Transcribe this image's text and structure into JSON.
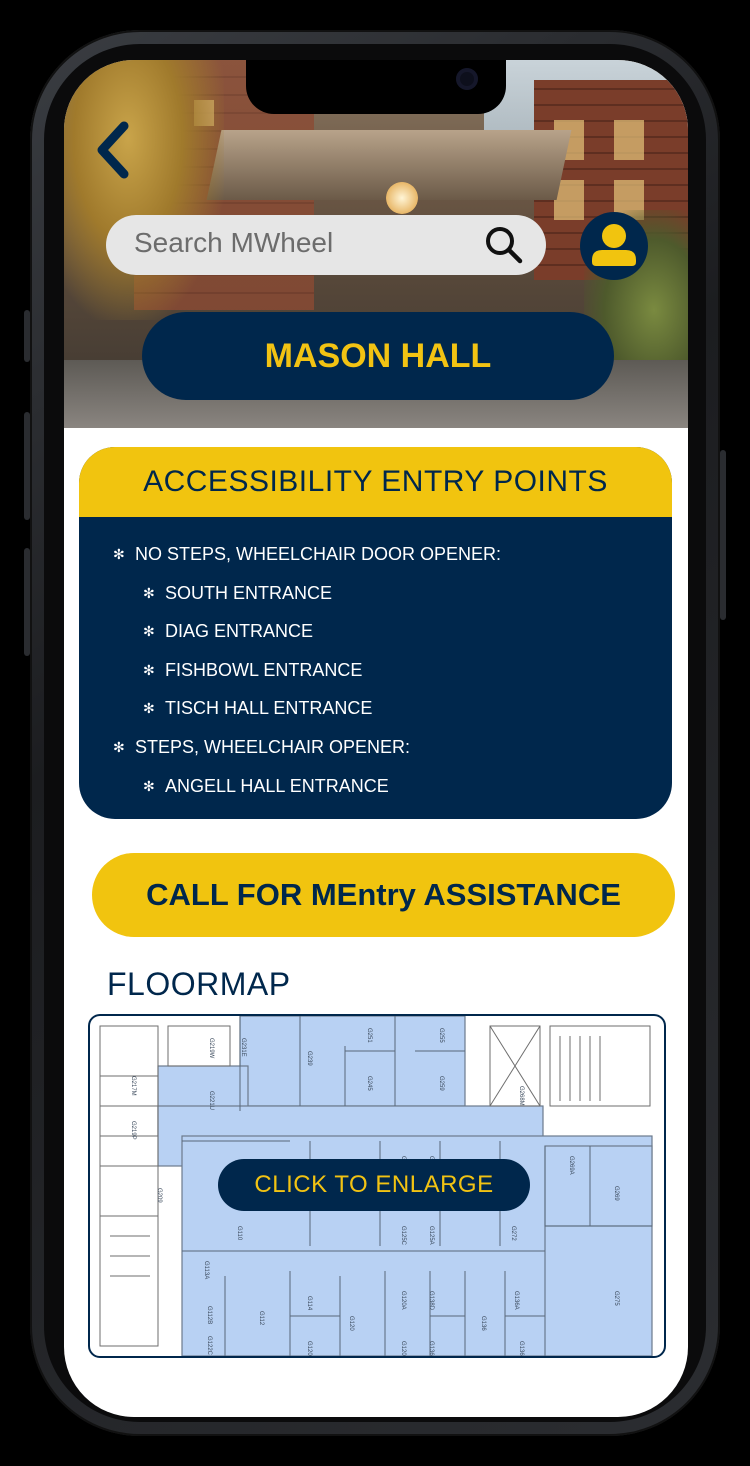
{
  "header": {
    "search_placeholder": "Search MWheel",
    "building_name": "MASON HALL"
  },
  "accessibility": {
    "title": "ACCESSIBILITY ENTRY POINTS",
    "items": [
      {
        "text": "NO STEPS, WHEELCHAIR DOOR OPENER:",
        "level": 1
      },
      {
        "text": "SOUTH ENTRANCE",
        "level": 2
      },
      {
        "text": "DIAG ENTRANCE",
        "level": 2
      },
      {
        "text": "FISHBOWL ENTRANCE",
        "level": 2
      },
      {
        "text": "TISCH HALL ENTRANCE",
        "level": 2
      },
      {
        "text": "STEPS, WHEELCHAIR OPENER:",
        "level": 1
      },
      {
        "text": "ANGELL HALL ENTRANCE",
        "level": 2
      }
    ],
    "bullet": "✻"
  },
  "call_button": "CALL FOR MEntry ASSISTANCE",
  "floormap": {
    "title": "FLOORMAP",
    "enlarge_label": "CLICK TO ENLARGE",
    "room_labels": [
      "G219W",
      "G231E",
      "G239",
      "G251",
      "G255",
      "G217M",
      "G221U",
      "G245",
      "G259",
      "G268M",
      "G219P",
      "G209",
      "G128",
      "G135",
      "G269A",
      "G269",
      "G110",
      "G125C",
      "G125A",
      "G272",
      "G113A",
      "G114",
      "G120A",
      "G138D",
      "G136A",
      "G275",
      "G112",
      "G120",
      "G136",
      "G122C",
      "G120C",
      "G120B",
      "G136C",
      "G136B",
      "G112B"
    ]
  },
  "colors": {
    "maize": "#f1c40f",
    "blue": "#00274c",
    "map_fill": "#b8d1f3"
  }
}
